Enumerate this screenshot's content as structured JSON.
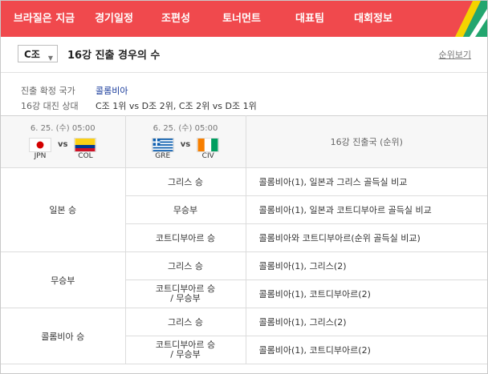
{
  "nav": {
    "items": [
      "브라질은 지금",
      "경기일정",
      "조편성",
      "토너먼트",
      "대표팀",
      "대회정보"
    ]
  },
  "colors": {
    "nav_bg": "#f0494d",
    "stripe_yellow": "#f5d400",
    "stripe_green": "#23a66f",
    "stripe_white": "#ffffff"
  },
  "header": {
    "group_select": "C조",
    "title": "16강 진출 경우의 수",
    "rank_link": "순위보기"
  },
  "info": {
    "qualified_label": "진출 확정 국가",
    "qualified_value": "콜롬비아",
    "opponent_label": "16강 대진 상대",
    "opponent_value": "C조 1위 vs D조 2위, C조 2위 vs D조 1위"
  },
  "table": {
    "match1": {
      "date": "6. 25. (수) 05:00",
      "home": "JPN",
      "away": "COL",
      "vs": "vs"
    },
    "match2": {
      "date": "6. 25. (수) 05:00",
      "home": "GRE",
      "away": "CIV",
      "vs": "vs"
    },
    "result_header": "16강 진출국 (순위)",
    "groups": [
      {
        "label": "일본 승",
        "rows": [
          {
            "cond": "그리스 승",
            "res": "콜롬비아(1), 일본과 그리스 골득실 비교"
          },
          {
            "cond": "무승부",
            "res": "콜롬비아(1), 일본과 코트디부아르 골득실 비교"
          },
          {
            "cond": "코트디부아르 승",
            "res": "콜롬비아와 코트디부아르(순위 골득실 비교)"
          }
        ]
      },
      {
        "label": "무승부",
        "rows": [
          {
            "cond": "그리스 승",
            "res": "콜롬비아(1), 그리스(2)"
          },
          {
            "cond1": "코트디부아르 승",
            "cond2": "/ 무승부",
            "res": "콜롬비아(1), 코트디부아르(2)"
          }
        ]
      },
      {
        "label": "콜롬비아 승",
        "rows": [
          {
            "cond": "그리스 승",
            "res": "콜롬비아(1), 그리스(2)"
          },
          {
            "cond1": "코트디부아르 승",
            "cond2": "/ 무승부",
            "res": "콜롬비아(1), 코트디부아르(2)"
          }
        ]
      }
    ]
  }
}
